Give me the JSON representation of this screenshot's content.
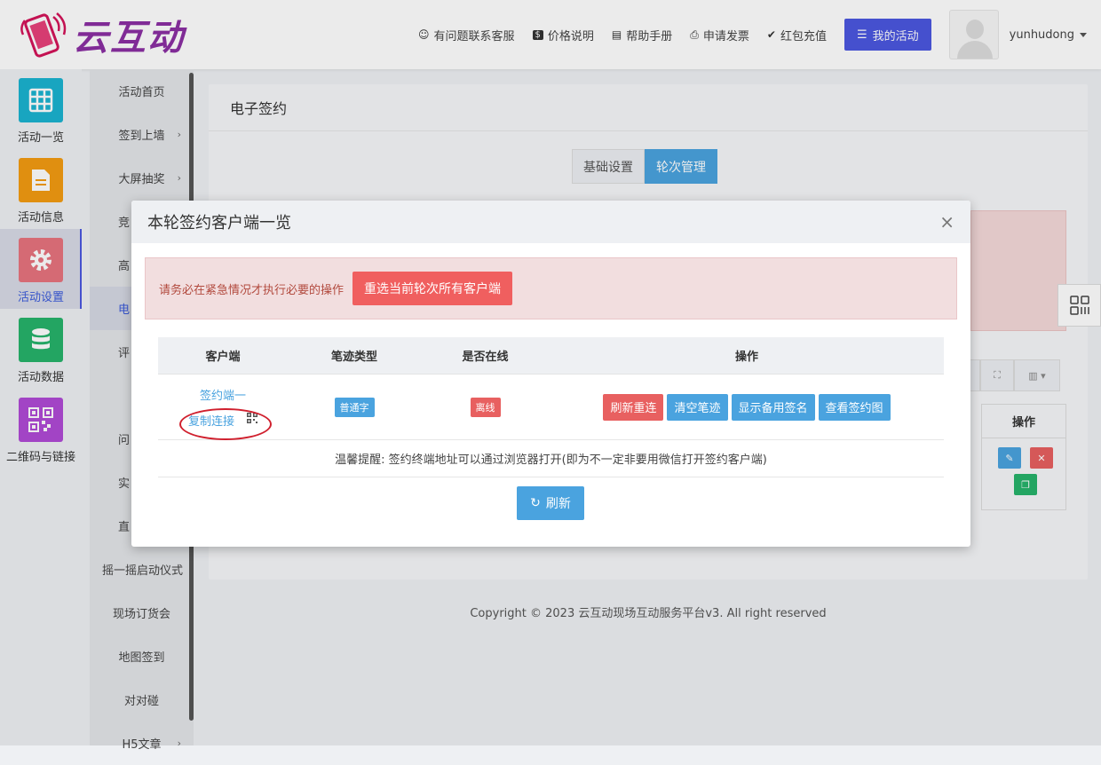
{
  "brand": {
    "name": "云互动"
  },
  "topnav": {
    "items": [
      {
        "icon": "user-plus-icon",
        "label": "有问题联系客服"
      },
      {
        "icon": "dollar-icon",
        "label": "价格说明"
      },
      {
        "icon": "book-icon",
        "label": "帮助手册"
      },
      {
        "icon": "printer-icon",
        "label": "申请发票"
      },
      {
        "icon": "shield-check-icon",
        "label": "红包充值"
      }
    ],
    "my_activity": "我的活动",
    "username": "yunhudong"
  },
  "side1": [
    {
      "label": "活动一览",
      "color": "#1bb3d1",
      "icon": "grid-icon"
    },
    {
      "label": "活动信息",
      "color": "#f39c12",
      "icon": "document-icon"
    },
    {
      "label": "活动设置",
      "color": "#e8737e",
      "icon": "gear-icon"
    },
    {
      "label": "活动数据",
      "color": "#26b36b",
      "icon": "database-icon"
    },
    {
      "label": "二维码与链接",
      "color": "#b04ad6",
      "icon": "qrcode-icon"
    }
  ],
  "side2": [
    {
      "label": "活动首页"
    },
    {
      "label": "签到上墙"
    },
    {
      "label": "大屏抽奖"
    },
    {
      "label": "竞"
    },
    {
      "label": "高"
    },
    {
      "label": "电"
    },
    {
      "label": "评"
    },
    {
      "label": ""
    },
    {
      "label": "问"
    },
    {
      "label": "实"
    },
    {
      "label": "直"
    },
    {
      "label": "摇一摇启动仪式"
    },
    {
      "label": "现场订货会"
    },
    {
      "label": "地图签到"
    },
    {
      "label": "对对碰"
    },
    {
      "label": "H5文章"
    }
  ],
  "main": {
    "title": "电子签约",
    "tabs": [
      "基础设置",
      "轮次管理"
    ],
    "op_header": "操作"
  },
  "footer": "Copyright © 2023 云互动现场互动服务平台v3. All right reserved",
  "modal": {
    "title": "本轮签约客户端一览",
    "close": "×",
    "alert_text": "请务必在紧急情况才执行必要的操作",
    "alert_button": "重选当前轮次所有客户端",
    "columns": [
      "客户端",
      "笔迹类型",
      "是否在线",
      "操作"
    ],
    "row": {
      "client": "签约端一",
      "copy": "复制连接",
      "type": "普通字",
      "status": "离线",
      "actions": [
        "刷新重连",
        "清空笔迹",
        "显示备用签名",
        "查看签约图"
      ]
    },
    "tip": "温馨提醒: 签约终端地址可以通过浏览器打开(即为不一定非要用微信打开签约客户端)",
    "refresh": "刷新"
  },
  "colors": {
    "primary": "#4aa3df",
    "danger": "#f05f5f",
    "accent": "#4b57e0"
  }
}
